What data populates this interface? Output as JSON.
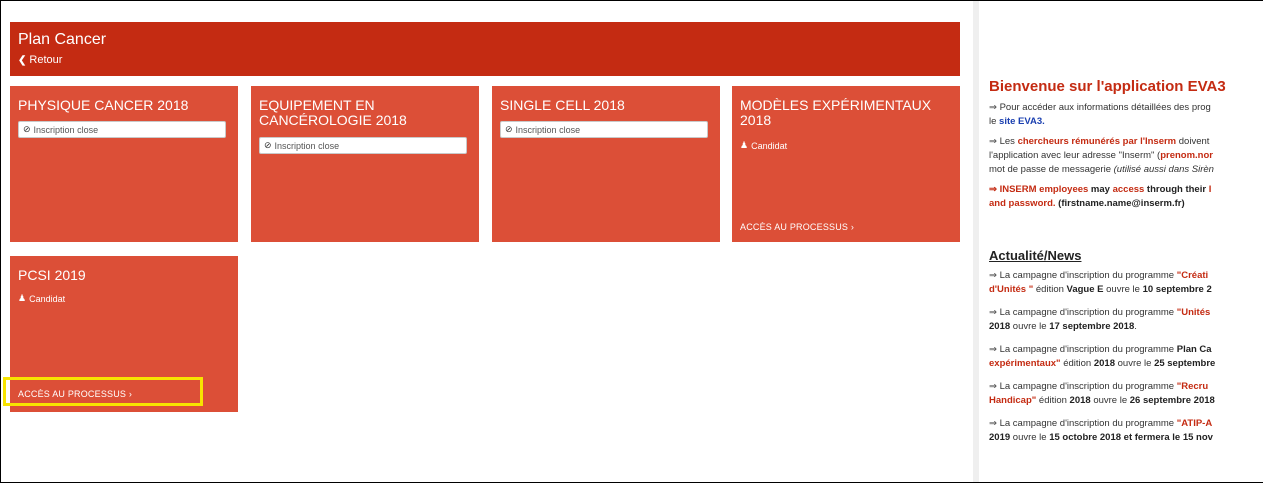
{
  "header": {
    "title": "Plan Cancer",
    "back_label": "Retour"
  },
  "tiles": [
    {
      "title": "PHYSIQUE CANCER 2018",
      "status": "Inscription close"
    },
    {
      "title": "EQUIPEMENT EN CANCÉROLOGIE 2018",
      "status": "Inscription close"
    },
    {
      "title": "SINGLE CELL 2018",
      "status": "Inscription close"
    },
    {
      "title": "MODÈLES EXPÉRIMENTAUX 2018",
      "role": "Candidat",
      "access": "ACCÈS AU PROCESSUS ›"
    },
    {
      "title": "PCSI 2019",
      "role": "Candidat",
      "access": "ACCÈS AU PROCESSUS ›"
    }
  ],
  "side": {
    "title": "Bienvenue sur l'application EVA3",
    "p1_a": "⇒ Pour accéder aux informations détaillées des prog",
    "p1_b_pre": "le ",
    "p1_b_link": "site EVA3.",
    "p2_a_pre": "⇒ Les ",
    "p2_a_red": "chercheurs rémunérés par l'Inserm",
    "p2_a_post": " doivent",
    "p2_b_pre": "l'application avec leur adresse \"Inserm\" (",
    "p2_b_red": "prenom.nor",
    "p2_c_pre": "mot de passe de messagerie ",
    "p2_c_ital": "(utilisé aussi dans Sirèn",
    "p3_a_red1": "⇒ INSERM employees",
    "p3_a_mid1": " may ",
    "p3_a_red2": "access",
    "p3_a_mid2": " through their ",
    "p3_a_red3": "I",
    "p3_b_red": "and password.",
    "p3_b_post": " (firstname.name@inserm.fr)",
    "news_title": "Actualité/News",
    "n1_a_pre": "⇒ La campagne d'inscription du programme ",
    "n1_a_red": "\"Créati",
    "n1_b_red": "d'Unités \"",
    "n1_b_mid": " édition ",
    "n1_b_bold1": "Vague E",
    "n1_b_mid2": " ouvre le ",
    "n1_b_bold2": "10 septembre 2",
    "n2_a_pre": "⇒ La campagne d'inscription du programme ",
    "n2_a_red": "\"Unités",
    "n2_b_bold1": "2018",
    "n2_b_mid": " ouvre le ",
    "n2_b_bold2": "17 septembre 2018",
    "n2_b_post": ".",
    "n3_a_pre": "⇒ La campagne d'inscription du programme ",
    "n3_a_bold": "Plan Ca",
    "n3_b_red": "expérimentaux\"",
    "n3_b_mid": " édition ",
    "n3_b_bold1": "2018",
    "n3_b_mid2": " ouvre le ",
    "n3_b_bold2": "25 septembre",
    "n4_a_pre": "⇒ La campagne d'inscription du programme ",
    "n4_a_red": "\"Recru",
    "n4_b_red": "Handicap\"",
    "n4_b_mid": " édition ",
    "n4_b_bold1": "2018",
    "n4_b_mid2": " ouvre le ",
    "n4_b_bold2": "26 septembre 2018",
    "n5_a_pre": "⇒ La campagne d'inscription du programme ",
    "n5_a_red": "\"ATIP-A",
    "n5_b_bold1": "2019",
    "n5_b_mid": " ouvre le ",
    "n5_b_bold2": "15 octobre 2018 et fermera le 15 nov"
  }
}
